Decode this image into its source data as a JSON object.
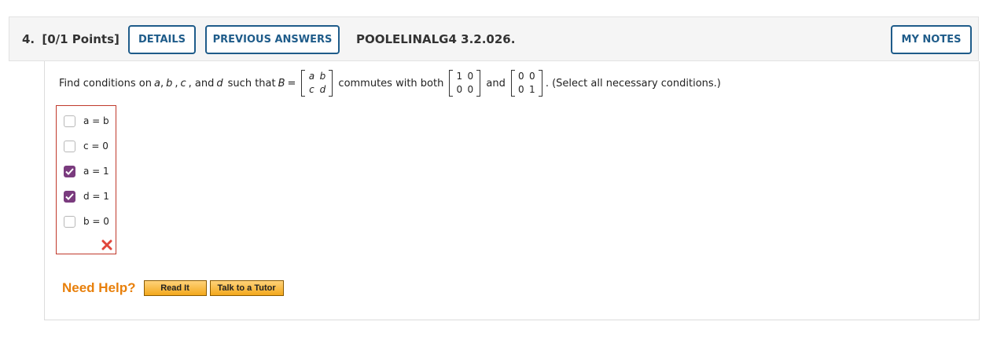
{
  "header": {
    "question_number": "4.",
    "points": "[0/1 Points]",
    "details_label": "DETAILS",
    "previous_answers_label": "PREVIOUS ANSWERS",
    "question_code": "POOLELINALG4 3.2.026.",
    "my_notes_label": "MY NOTES"
  },
  "question": {
    "part1": "Find conditions on",
    "var_a": "a",
    "sep1": ",",
    "var_b": "b",
    "sep2": ",",
    "var_c": "c",
    "and1": ", and",
    "var_d": "d",
    "part2": "such that",
    "var_B": "B",
    "equals": "=",
    "part3": "commutes with both",
    "and2": "and",
    "part4": ". (Select all necessary conditions.)",
    "matrix_B": [
      [
        "a",
        "b"
      ],
      [
        "c",
        "d"
      ]
    ],
    "matrix_1": [
      [
        "1",
        "0"
      ],
      [
        "0",
        "0"
      ]
    ],
    "matrix_2": [
      [
        "0",
        "0"
      ],
      [
        "0",
        "1"
      ]
    ]
  },
  "choices": [
    {
      "label": "a = b",
      "checked": false
    },
    {
      "label": "c = 0",
      "checked": false
    },
    {
      "label": "a = 1",
      "checked": true
    },
    {
      "label": "d = 1",
      "checked": true
    },
    {
      "label": "b = 0",
      "checked": false
    }
  ],
  "result_icon": "incorrect-x-icon",
  "help": {
    "label": "Need Help?",
    "read_it": "Read It",
    "tutor": "Talk to a Tutor"
  },
  "colors": {
    "accent": "#1f5c8a",
    "checked": "#7a3b7e",
    "error_border": "#c0392b",
    "help_orange": "#e8800c"
  }
}
